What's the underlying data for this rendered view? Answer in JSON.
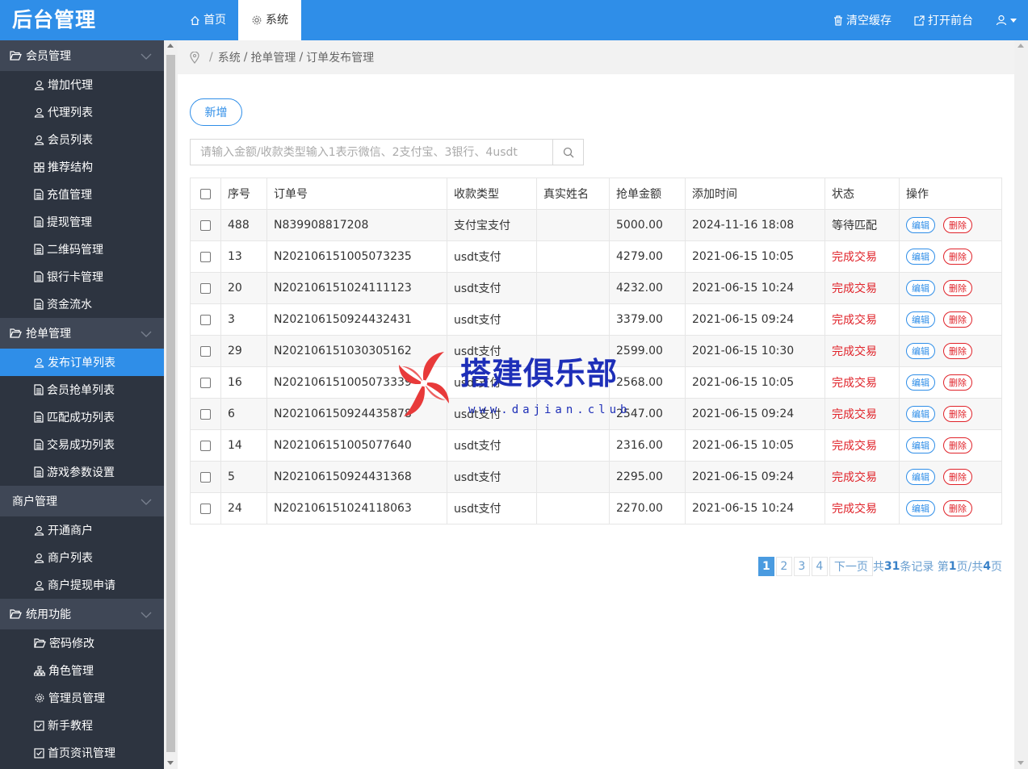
{
  "app": {
    "title": "后台管理"
  },
  "topnav": {
    "tabs": [
      {
        "label": "首页",
        "icon": "home-icon"
      },
      {
        "label": "系统",
        "icon": "gear-icon"
      }
    ]
  },
  "topright": {
    "clear_cache": "清空缓存",
    "open_front": "打开前台"
  },
  "sidebar": {
    "groups": [
      {
        "label": "会员管理",
        "items": [
          "增加代理",
          "代理列表",
          "会员列表",
          "推荐结构",
          "充值管理",
          "提现管理",
          "二维码管理",
          "银行卡管理",
          "资金流水"
        ]
      },
      {
        "label": "抢单管理",
        "items": [
          "发布订单列表",
          "会员抢单列表",
          "匹配成功列表",
          "交易成功列表",
          "游戏参数设置"
        ]
      },
      {
        "label": "商户管理",
        "items": [
          "开通商户",
          "商户列表",
          "商户提现申请"
        ]
      },
      {
        "label": "统用功能",
        "items": [
          "密码修改",
          "角色管理",
          "管理员管理",
          "新手教程",
          "首页资讯管理"
        ]
      }
    ]
  },
  "breadcrumb": {
    "items": [
      "系统",
      "抢单管理",
      "订单发布管理"
    ]
  },
  "toolbar": {
    "add_label": "新增"
  },
  "search": {
    "placeholder": "请输入金额/收款类型输入1表示微信、2支付宝、3银行、4usdt",
    "value": ""
  },
  "table": {
    "headers": [
      "序号",
      "订单号",
      "收款类型",
      "真实姓名",
      "抢单金额",
      "添加时间",
      "状态",
      "操作"
    ],
    "edit_label": "编辑",
    "delete_label": "删除",
    "rows": [
      {
        "id": "488",
        "order": "N839908817208",
        "type": "支付宝支付",
        "name": "",
        "amount": "5000.00",
        "time": "2024-11-16 18:08",
        "status": "等待匹配"
      },
      {
        "id": "13",
        "order": "N202106151005073235",
        "type": "usdt支付",
        "name": "",
        "amount": "4279.00",
        "time": "2021-06-15 10:05",
        "status": "完成交易"
      },
      {
        "id": "20",
        "order": "N202106151024111123",
        "type": "usdt支付",
        "name": "",
        "amount": "4232.00",
        "time": "2021-06-15 10:24",
        "status": "完成交易"
      },
      {
        "id": "3",
        "order": "N202106150924432431",
        "type": "usdt支付",
        "name": "",
        "amount": "3379.00",
        "time": "2021-06-15 09:24",
        "status": "完成交易"
      },
      {
        "id": "29",
        "order": "N202106151030305162",
        "type": "usdt支付",
        "name": "",
        "amount": "2599.00",
        "time": "2021-06-15 10:30",
        "status": "完成交易"
      },
      {
        "id": "16",
        "order": "N202106151005073339",
        "type": "usdt支付",
        "name": "",
        "amount": "2568.00",
        "time": "2021-06-15 10:05",
        "status": "完成交易"
      },
      {
        "id": "6",
        "order": "N202106150924435878",
        "type": "usdt支付",
        "name": "",
        "amount": "2547.00",
        "time": "2021-06-15 09:24",
        "status": "完成交易"
      },
      {
        "id": "14",
        "order": "N202106151005077640",
        "type": "usdt支付",
        "name": "",
        "amount": "2316.00",
        "time": "2021-06-15 10:05",
        "status": "完成交易"
      },
      {
        "id": "5",
        "order": "N202106150924431368",
        "type": "usdt支付",
        "name": "",
        "amount": "2295.00",
        "time": "2021-06-15 09:24",
        "status": "完成交易"
      },
      {
        "id": "24",
        "order": "N202106151024118063",
        "type": "usdt支付",
        "name": "",
        "amount": "2270.00",
        "time": "2021-06-15 10:24",
        "status": "完成交易"
      }
    ]
  },
  "pager": {
    "pages": [
      "1",
      "2",
      "3",
      "4"
    ],
    "next": "下一页",
    "total_prefix": "共",
    "total_count": "31",
    "total_suffix": "条记录 第",
    "current": "1",
    "pages_mid": "页/共",
    "page_count": "4",
    "pages_suffix": "页"
  },
  "watermark": {
    "text": "搭建俱乐部",
    "url": "www.dajian.club"
  },
  "colors": {
    "primary": "#2f8ee8",
    "sidebar_bg": "#2d3440",
    "group_bg": "#3f4756",
    "danger": "#e0232a"
  }
}
